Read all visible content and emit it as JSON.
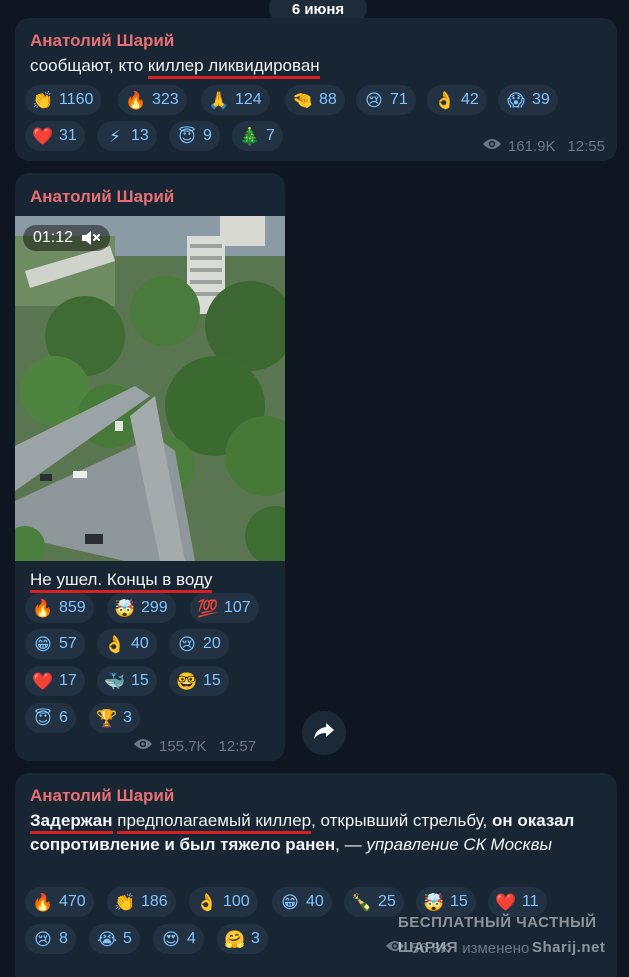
{
  "date_label": "6 июня",
  "messages": [
    {
      "author": "Анатолий Шарий",
      "text_before": "сообщают, кто ",
      "text_underlined": "киллер ликвидирован",
      "reactions": [
        {
          "emoji": "👏",
          "count": "1160"
        },
        {
          "emoji": "🔥",
          "count": "323"
        },
        {
          "emoji": "🙏",
          "count": "124"
        },
        {
          "emoji": "🤏",
          "count": "88"
        },
        {
          "emoji": "😢",
          "count": "71"
        },
        {
          "emoji": "👌",
          "count": "42"
        },
        {
          "emoji": "😱",
          "count": "39"
        },
        {
          "emoji": "❤️",
          "count": "31"
        },
        {
          "emoji": "⚡",
          "count": "13"
        },
        {
          "emoji": "😇",
          "count": "9"
        },
        {
          "emoji": "🎄",
          "count": "7"
        }
      ],
      "views": "161.9K",
      "time": "12:55"
    },
    {
      "author": "Анатолий Шарий",
      "video_duration": "01:12",
      "text_underlined": "Не ушел. Концы в воду",
      "reactions": [
        {
          "emoji": "🔥",
          "count": "859"
        },
        {
          "emoji": "🤯",
          "count": "299"
        },
        {
          "emoji": "💯",
          "count": "107"
        },
        {
          "emoji": "😁",
          "count": "57"
        },
        {
          "emoji": "👌",
          "count": "40"
        },
        {
          "emoji": "😢",
          "count": "20"
        },
        {
          "emoji": "❤️",
          "count": "17"
        },
        {
          "emoji": "🐳",
          "count": "15"
        },
        {
          "emoji": "🤓",
          "count": "15"
        },
        {
          "emoji": "😇",
          "count": "6"
        },
        {
          "emoji": "🏆",
          "count": "3"
        }
      ],
      "views": "155.7K",
      "time": "12:57"
    },
    {
      "author": "Анатолий Шарий",
      "text_bold_underlined": "Задержан",
      "text_space": " ",
      "text_underlined": "предполагаемый киллер",
      "text_mid": ", открывший стрельбу, ",
      "text_bold": "он оказал сопротивление и был тяжело ранен",
      "text_dash": ", — ",
      "text_italic": "управление СК Москвы",
      "reactions": [
        {
          "emoji": "🔥",
          "count": "470"
        },
        {
          "emoji": "👏",
          "count": "186"
        },
        {
          "emoji": "👌",
          "count": "100"
        },
        {
          "emoji": "😁",
          "count": "40"
        },
        {
          "emoji": "🍾",
          "count": "25"
        },
        {
          "emoji": "🤯",
          "count": "15"
        },
        {
          "emoji": "❤️",
          "count": "11"
        },
        {
          "emoji": "😢",
          "count": "8"
        },
        {
          "emoji": "😭",
          "count": "5"
        },
        {
          "emoji": "😍",
          "count": "4"
        },
        {
          "emoji": "🤗",
          "count": "3"
        }
      ],
      "views_partial": "56.8K",
      "edited_label": "изменено"
    }
  ],
  "watermark": {
    "line1": "БЕСПЛАТНЫЙ ЧАСТНЫЙ",
    "line2": "ШАРИЯ",
    "site": "Sharij.net"
  },
  "colors": {
    "background": "#0e1621",
    "bubble": "#182533",
    "author": "#e66f75",
    "reaction_count": "#7fc4ff",
    "underline": "#d81f26",
    "meta": "#6c7883"
  },
  "icons": {
    "views": "eye-icon",
    "mute": "muted-speaker-icon",
    "share": "share-arrow-icon"
  }
}
